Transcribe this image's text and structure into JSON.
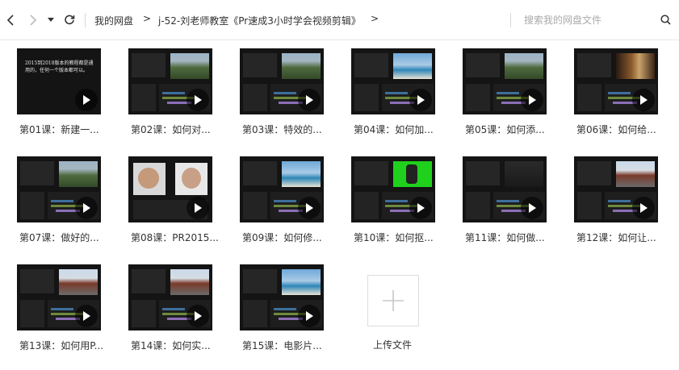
{
  "header": {
    "breadcrumbs": [
      "我的网盘",
      "j-52-刘老师教室《Pr速成3小时学会视频剪辑》"
    ],
    "search_placeholder": "搜索我的网盘文件"
  },
  "files": [
    {
      "caption": "第01课：新建一...",
      "thumb": "title",
      "thumb_text": "2015到2018版本的教程都是通用的，任何一个版本都可以。"
    },
    {
      "caption": "第02课：如何对...",
      "thumb": "forest"
    },
    {
      "caption": "第03课：特效的...",
      "thumb": "forest"
    },
    {
      "caption": "第04课：如何加...",
      "thumb": "sea"
    },
    {
      "caption": "第05课：如何添...",
      "thumb": "forest"
    },
    {
      "caption": "第06课：如何给...",
      "thumb": "room"
    },
    {
      "caption": "第07课：做好的...",
      "thumb": "forest"
    },
    {
      "caption": "第08课：PR2015...",
      "thumb": "faces"
    },
    {
      "caption": "第09课：如何修...",
      "thumb": "sea"
    },
    {
      "caption": "第10课：如何抠...",
      "thumb": "green"
    },
    {
      "caption": "第11课：如何做...",
      "thumb": "dark"
    },
    {
      "caption": "第12课：如何让...",
      "thumb": "temple"
    },
    {
      "caption": "第13课：如何用P...",
      "thumb": "temple"
    },
    {
      "caption": "第14课：如何实...",
      "thumb": "temple"
    },
    {
      "caption": "第15课：电影片...",
      "thumb": "sea"
    }
  ],
  "upload": {
    "label": "上传文件"
  },
  "colors": {
    "accent": "#06a7ff",
    "separator": "#e8e8e8"
  }
}
